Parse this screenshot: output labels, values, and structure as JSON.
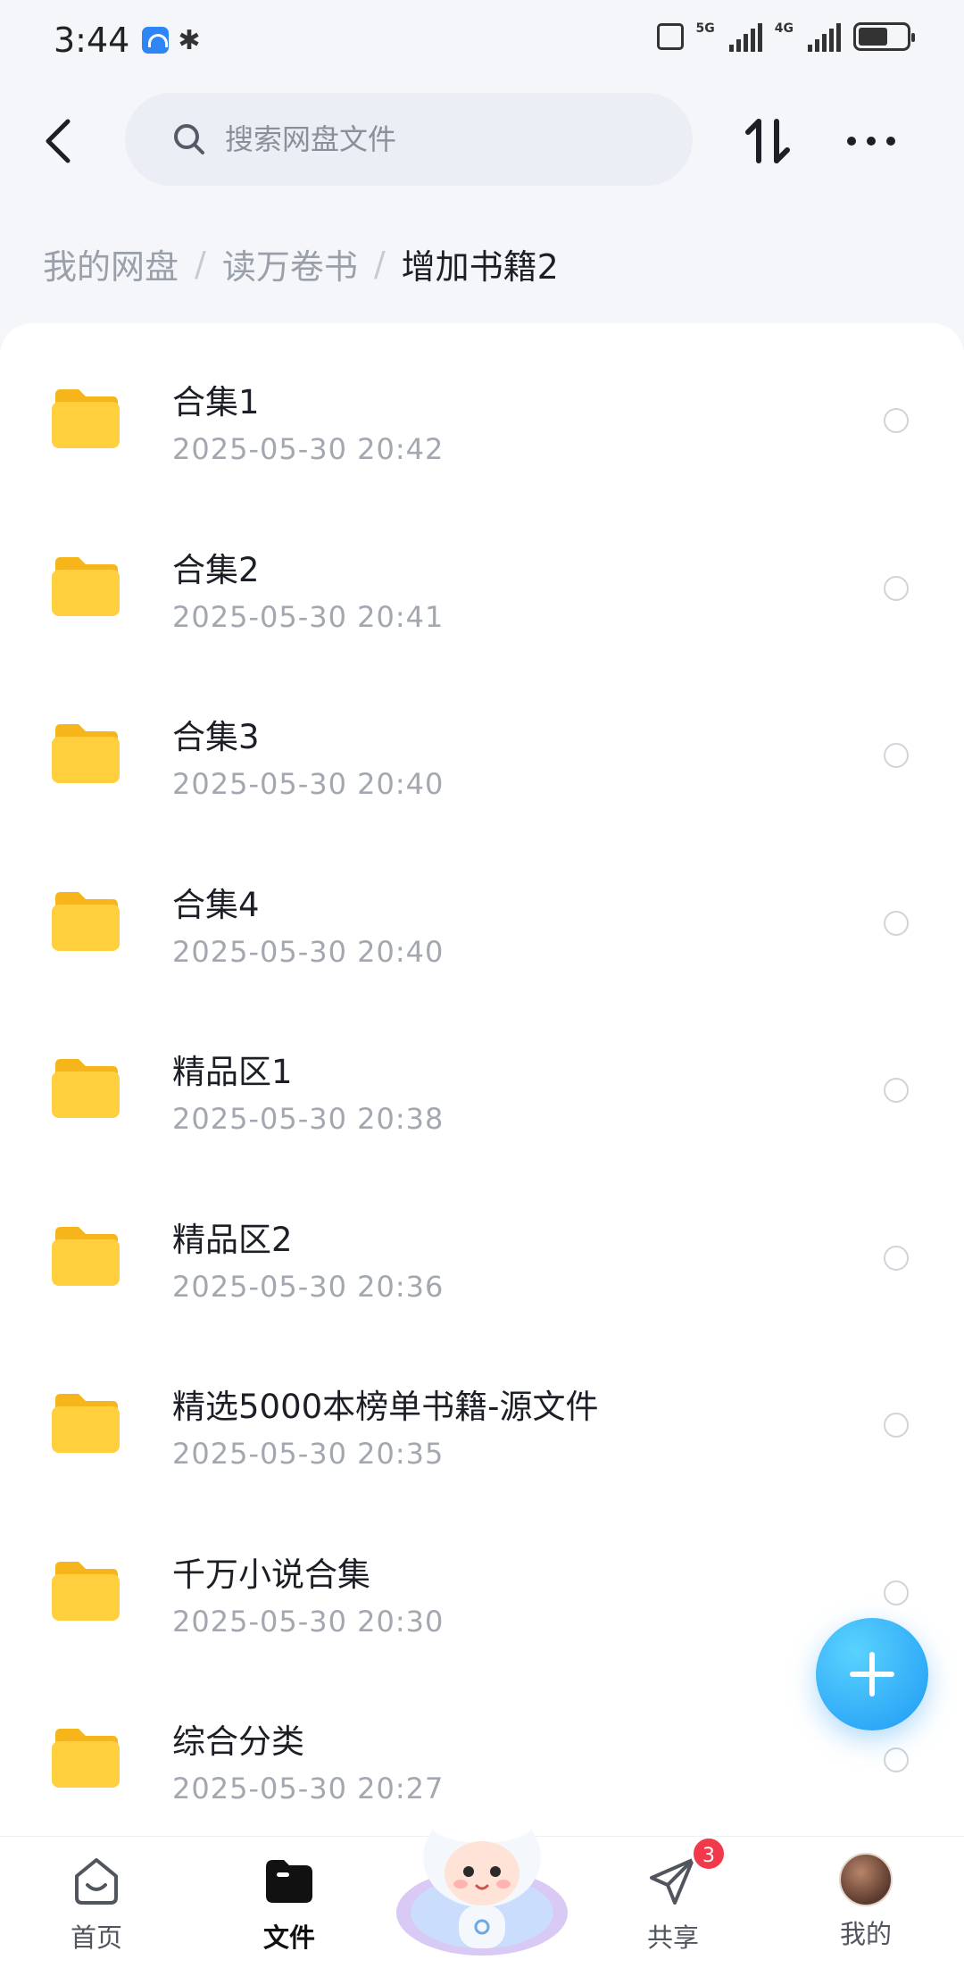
{
  "status_bar": {
    "time": "3:44",
    "network_1": "5G",
    "network_2": "4G"
  },
  "header": {
    "search_placeholder": "搜索网盘文件"
  },
  "breadcrumb": {
    "items": [
      "我的网盘",
      "读万卷书",
      "增加书籍2"
    ],
    "separator": "/"
  },
  "files": [
    {
      "name": "合集1",
      "date": "2025-05-30  20:42"
    },
    {
      "name": "合集2",
      "date": "2025-05-30  20:41"
    },
    {
      "name": "合集3",
      "date": "2025-05-30  20:40"
    },
    {
      "name": "合集4",
      "date": "2025-05-30  20:40"
    },
    {
      "name": "精品区1",
      "date": "2025-05-30  20:38"
    },
    {
      "name": "精品区2",
      "date": "2025-05-30  20:36"
    },
    {
      "name": "精选5000本榜单书籍-源文件",
      "date": "2025-05-30  20:35"
    },
    {
      "name": "千万小说合集",
      "date": "2025-05-30  20:30"
    },
    {
      "name": "综合分类",
      "date": "2025-05-30  20:27"
    }
  ],
  "tab_bar": {
    "home": "首页",
    "files": "文件",
    "share": "共享",
    "share_badge": "3",
    "mine": "我的"
  },
  "colors": {
    "accent": "#1e9af3",
    "folder": "#ffc62e",
    "badge": "#f2394b"
  }
}
